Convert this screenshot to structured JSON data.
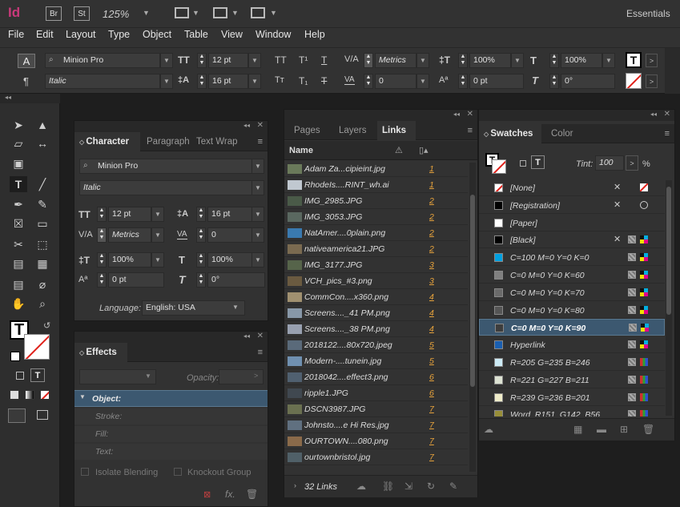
{
  "app": {
    "logo": "Id",
    "br": "Br",
    "st": "St",
    "zoom": "125%",
    "workspace": "Essentials"
  },
  "menu": [
    "File",
    "Edit",
    "Layout",
    "Type",
    "Object",
    "Table",
    "View",
    "Window",
    "Help"
  ],
  "control": {
    "font_family": "Minion Pro",
    "font_style": "Italic",
    "font_size": "12 pt",
    "leading": "16 pt",
    "kerning": "Metrics",
    "tracking": "0",
    "vscale": "100%",
    "hscale": "100%",
    "baseline": "0 pt",
    "skew": "0°"
  },
  "character": {
    "tabs": [
      "Character",
      "Paragraph",
      "Text Wrap"
    ],
    "font_family": "Minion Pro",
    "font_style": "Italic",
    "font_size": "12 pt",
    "leading": "16 pt",
    "kerning": "Metrics",
    "tracking": "0",
    "vscale": "100%",
    "hscale": "100%",
    "baseline": "0 pt",
    "skew": "0°",
    "language_label": "Language:",
    "language": "English: USA"
  },
  "effects": {
    "title": "Effects",
    "opacity_label": "Opacity:",
    "object_label": "Object:",
    "items": [
      "Stroke:",
      "Fill:",
      "Text:"
    ],
    "isolate": "Isolate Blending",
    "knockout": "Knockout Group"
  },
  "links": {
    "tabs": [
      "Pages",
      "Layers",
      "Links"
    ],
    "col_name": "Name",
    "count": "32 Links",
    "rows": [
      {
        "name": "Adam Za...cipieint.jpg",
        "page": "1",
        "color": "#6a7a5a"
      },
      {
        "name": "RhodeIs....RINT_wh.ai",
        "page": "1",
        "color": "#c0c8d0"
      },
      {
        "name": "IMG_2985.JPG",
        "page": "2",
        "color": "#4a5a48"
      },
      {
        "name": "IMG_3053.JPG",
        "page": "2",
        "color": "#5a6860"
      },
      {
        "name": "NatAmer....0plain.png",
        "page": "2",
        "color": "#3a7ab0"
      },
      {
        "name": "nativeamerica21.JPG",
        "page": "2",
        "color": "#7a6a50"
      },
      {
        "name": "IMG_3177.JPG",
        "page": "3",
        "color": "#56644a"
      },
      {
        "name": "VCH_pics_#3.png",
        "page": "3",
        "color": "#6a5a40"
      },
      {
        "name": "CommCon....x360.png",
        "page": "4",
        "color": "#a09070"
      },
      {
        "name": "Screens...._41 PM.png",
        "page": "4",
        "color": "#8898a8"
      },
      {
        "name": "Screens...._38 PM.png",
        "page": "4",
        "color": "#98a0b0"
      },
      {
        "name": "2018122....80x720.jpeg",
        "page": "5",
        "color": "#5a6a7a"
      },
      {
        "name": "Modern-....tunein.jpg",
        "page": "5",
        "color": "#7090b0"
      },
      {
        "name": "2018042....effect3.png",
        "page": "6",
        "color": "#506070"
      },
      {
        "name": "ripple1.JPG",
        "page": "6",
        "color": "#404850"
      },
      {
        "name": "DSCN3987.JPG",
        "page": "7",
        "color": "#6a7050"
      },
      {
        "name": "Johnsto....e Hi Res.jpg",
        "page": "7",
        "color": "#607080"
      },
      {
        "name": "OURTOWN....080.png",
        "page": "7",
        "color": "#8a6a4a"
      },
      {
        "name": "ourtownbristol.jpg",
        "page": "7",
        "color": "#506068"
      }
    ]
  },
  "swatches": {
    "tabs": [
      "Swatches",
      "Color"
    ],
    "tint_label": "Tint:",
    "tint": "100",
    "pct": "%",
    "rows": [
      {
        "name": "[None]",
        "color": "none"
      },
      {
        "name": "[Registration]",
        "color": "#000000"
      },
      {
        "name": "[Paper]",
        "color": "#ffffff"
      },
      {
        "name": "[Black]",
        "color": "#000000"
      },
      {
        "name": "C=100 M=0 Y=0 K=0",
        "color": "#00a0e0"
      },
      {
        "name": "C=0 M=0 Y=0 K=60",
        "color": "#808080"
      },
      {
        "name": "C=0 M=0 Y=0 K=70",
        "color": "#6a6a6a"
      },
      {
        "name": "C=0 M=0 Y=0 K=80",
        "color": "#555555"
      },
      {
        "name": "C=0 M=0 Y=0 K=90",
        "color": "#3d3d3d"
      },
      {
        "name": "Hyperlink",
        "color": "#1a5fb0"
      },
      {
        "name": "R=205 G=235 B=246",
        "color": "#cdebf6"
      },
      {
        "name": "R=221 G=227 B=211",
        "color": "#dde3d3"
      },
      {
        "name": "R=239 G=236 B=201",
        "color": "#efecc9"
      },
      {
        "name": "Word_R151_G142_B56",
        "color": "#978e38"
      }
    ]
  }
}
